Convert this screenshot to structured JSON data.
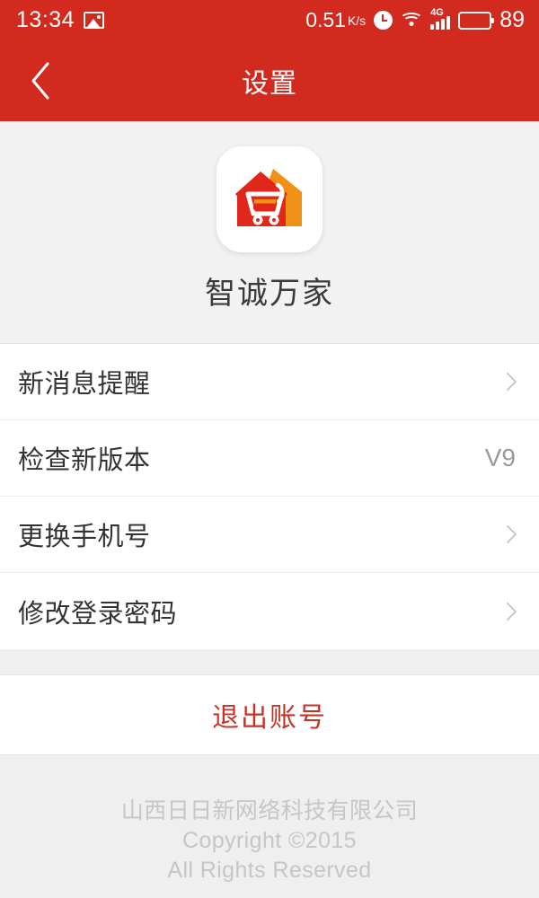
{
  "status_bar": {
    "time": "13:34",
    "photo_icon": "image-icon",
    "net_speed": "0.51",
    "net_speed_unit": "K/s",
    "alarm_icon": "alarm-clock-icon",
    "wifi_icon": "wifi-icon",
    "network_type": "4G",
    "signal_icon": "signal-bars-icon",
    "battery_icon": "battery-icon",
    "battery_level": "89"
  },
  "navbar": {
    "back_icon": "chevron-left-icon",
    "title": "设置"
  },
  "app": {
    "logo_icon": "house-shopping-cart-logo",
    "name": "智诚万家"
  },
  "settings": {
    "rows": [
      {
        "label": "新消息提醒",
        "value": "",
        "chevron": true
      },
      {
        "label": "检查新版本",
        "value": "V9",
        "chevron": false
      },
      {
        "label": "更换手机号",
        "value": "",
        "chevron": true
      },
      {
        "label": "修改登录密码",
        "value": "",
        "chevron": true
      }
    ]
  },
  "logout": {
    "label": "退出账号"
  },
  "footer": {
    "line1": "山西日日新网络科技有限公司",
    "line2": "Copyright ©2015",
    "line3": "All Rights Reserved"
  },
  "colors": {
    "brand_red": "#d22a1e",
    "logout_red": "#c93226",
    "page_bg": "#efeff0",
    "row_bg": "#ffffff",
    "label_text": "#333333",
    "muted_text": "#9a9a9a",
    "footer_text": "#c6c6c6",
    "logo_house_red": "#e0271c",
    "logo_house_orange": "#f09017"
  }
}
